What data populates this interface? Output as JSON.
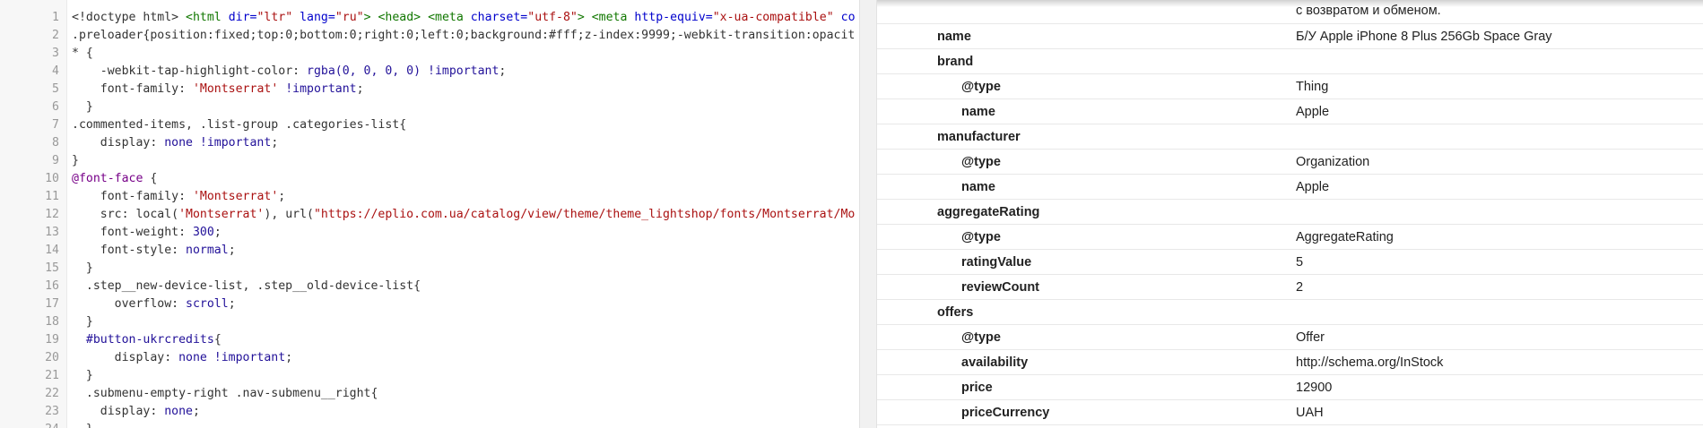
{
  "editor": {
    "lines": [
      {
        "n": "1",
        "tokens": [
          [
            "c-plain",
            "<!doctype html> "
          ],
          [
            "c-tag",
            "<html "
          ],
          [
            "c-attr",
            "dir="
          ],
          [
            "c-str",
            "\"ltr\""
          ],
          [
            "c-plain",
            " "
          ],
          [
            "c-attr",
            "lang="
          ],
          [
            "c-str",
            "\"ru\""
          ],
          [
            "c-tag",
            ">"
          ],
          [
            "c-plain",
            " "
          ],
          [
            "c-tag",
            "<head>"
          ],
          [
            "c-plain",
            " "
          ],
          [
            "c-tag",
            "<meta "
          ],
          [
            "c-attr",
            "charset="
          ],
          [
            "c-str",
            "\"utf-8\""
          ],
          [
            "c-tag",
            ">"
          ],
          [
            "c-plain",
            " "
          ],
          [
            "c-tag",
            "<meta "
          ],
          [
            "c-attr",
            "http-equiv="
          ],
          [
            "c-str",
            "\"x-ua-compatible\""
          ],
          [
            "c-plain",
            " "
          ],
          [
            "c-attr",
            "co"
          ]
        ]
      },
      {
        "n": "2",
        "tokens": [
          [
            "c-sel",
            ".preloader"
          ],
          [
            "c-plain",
            "{position:fixed;top:0;bottom:0;right:0;left:0;background:#fff;z-index:9999;-webkit-transition:opacit"
          ]
        ]
      },
      {
        "n": "3",
        "tokens": [
          [
            "c-sel",
            "* {"
          ]
        ]
      },
      {
        "n": "4",
        "tokens": [
          [
            "c-plain",
            "    "
          ],
          [
            "c-prop",
            "-webkit-tap-highlight-color"
          ],
          [
            "c-plain",
            ": "
          ],
          [
            "c-val",
            "rgba(0, 0, 0, 0) !important"
          ],
          [
            "c-plain",
            ";"
          ]
        ]
      },
      {
        "n": "5",
        "tokens": [
          [
            "c-plain",
            "    font-family: "
          ],
          [
            "c-str",
            "'Montserrat'"
          ],
          [
            "c-plain",
            " "
          ],
          [
            "c-val",
            "!important"
          ],
          [
            "c-plain",
            ";"
          ]
        ]
      },
      {
        "n": "6",
        "tokens": [
          [
            "c-plain",
            "  }"
          ]
        ]
      },
      {
        "n": "7",
        "tokens": [
          [
            "c-sel",
            ".commented-items, .list-group .categories-list{"
          ]
        ]
      },
      {
        "n": "8",
        "tokens": [
          [
            "c-plain",
            "    display: "
          ],
          [
            "c-val",
            "none !important"
          ],
          [
            "c-plain",
            ";"
          ]
        ]
      },
      {
        "n": "9",
        "tokens": [
          [
            "c-plain",
            "}"
          ]
        ]
      },
      {
        "n": "10",
        "tokens": [
          [
            "c-dir",
            "@font-face"
          ],
          [
            "c-plain",
            " {"
          ]
        ]
      },
      {
        "n": "11",
        "tokens": [
          [
            "c-plain",
            "    font-family: "
          ],
          [
            "c-str",
            "'Montserrat'"
          ],
          [
            "c-plain",
            ";"
          ]
        ]
      },
      {
        "n": "12",
        "tokens": [
          [
            "c-plain",
            "    src: local("
          ],
          [
            "c-str",
            "'Montserrat'"
          ],
          [
            "c-plain",
            "), url("
          ],
          [
            "c-str",
            "\"https://eplio.com.ua/catalog/view/theme/theme_lightshop/fonts/Montserrat/Mo"
          ]
        ]
      },
      {
        "n": "13",
        "tokens": [
          [
            "c-plain",
            "    font-weight: "
          ],
          [
            "c-val",
            "300"
          ],
          [
            "c-plain",
            ";"
          ]
        ]
      },
      {
        "n": "14",
        "tokens": [
          [
            "c-plain",
            "    font-style: "
          ],
          [
            "c-val",
            "normal"
          ],
          [
            "c-plain",
            ";"
          ]
        ]
      },
      {
        "n": "15",
        "tokens": [
          [
            "c-plain",
            "  }"
          ]
        ]
      },
      {
        "n": "16",
        "tokens": [
          [
            "c-sel",
            "  .step__new-device-list, .step__old-device-list{"
          ]
        ]
      },
      {
        "n": "17",
        "tokens": [
          [
            "c-plain",
            "      overflow: "
          ],
          [
            "c-val",
            "scroll"
          ],
          [
            "c-plain",
            ";"
          ]
        ]
      },
      {
        "n": "18",
        "tokens": [
          [
            "c-plain",
            "  }"
          ]
        ]
      },
      {
        "n": "19",
        "tokens": [
          [
            "c-plain",
            "  "
          ],
          [
            "c-val",
            "#button-ukrcredits"
          ],
          [
            "c-plain",
            "{"
          ]
        ]
      },
      {
        "n": "20",
        "tokens": [
          [
            "c-plain",
            "      display: "
          ],
          [
            "c-val",
            "none !important"
          ],
          [
            "c-plain",
            ";"
          ]
        ]
      },
      {
        "n": "21",
        "tokens": [
          [
            "c-plain",
            "  }"
          ]
        ]
      },
      {
        "n": "22",
        "tokens": [
          [
            "c-sel",
            "  .submenu-empty-right .nav-submenu__right{"
          ]
        ]
      },
      {
        "n": "23",
        "tokens": [
          [
            "c-plain",
            "    display: "
          ],
          [
            "c-val",
            "none"
          ],
          [
            "c-plain",
            ";"
          ]
        ]
      },
      {
        "n": "24",
        "tokens": [
          [
            "c-plain",
            "  }"
          ]
        ]
      }
    ]
  },
  "structured_data": {
    "continuation_text": "с возвратом и обменом.",
    "rows": [
      {
        "key": "name",
        "level": 0,
        "value": "Б/У Apple iPhone 8 Plus 256Gb Space Gray"
      },
      {
        "key": "brand",
        "level": 0,
        "value": ""
      },
      {
        "key": "@type",
        "level": 1,
        "value": "Thing"
      },
      {
        "key": "name",
        "level": 1,
        "value": "Apple"
      },
      {
        "key": "manufacturer",
        "level": 0,
        "value": ""
      },
      {
        "key": "@type",
        "level": 1,
        "value": "Organization"
      },
      {
        "key": "name",
        "level": 1,
        "value": "Apple"
      },
      {
        "key": "aggregateRating",
        "level": 0,
        "value": ""
      },
      {
        "key": "@type",
        "level": 1,
        "value": "AggregateRating"
      },
      {
        "key": "ratingValue",
        "level": 1,
        "value": "5"
      },
      {
        "key": "reviewCount",
        "level": 1,
        "value": "2"
      },
      {
        "key": "offers",
        "level": 0,
        "value": ""
      },
      {
        "key": "@type",
        "level": 1,
        "value": "Offer"
      },
      {
        "key": "availability",
        "level": 1,
        "value": "http://schema.org/InStock"
      },
      {
        "key": "price",
        "level": 1,
        "value": "12900"
      },
      {
        "key": "priceCurrency",
        "level": 1,
        "value": "UAH"
      }
    ]
  }
}
